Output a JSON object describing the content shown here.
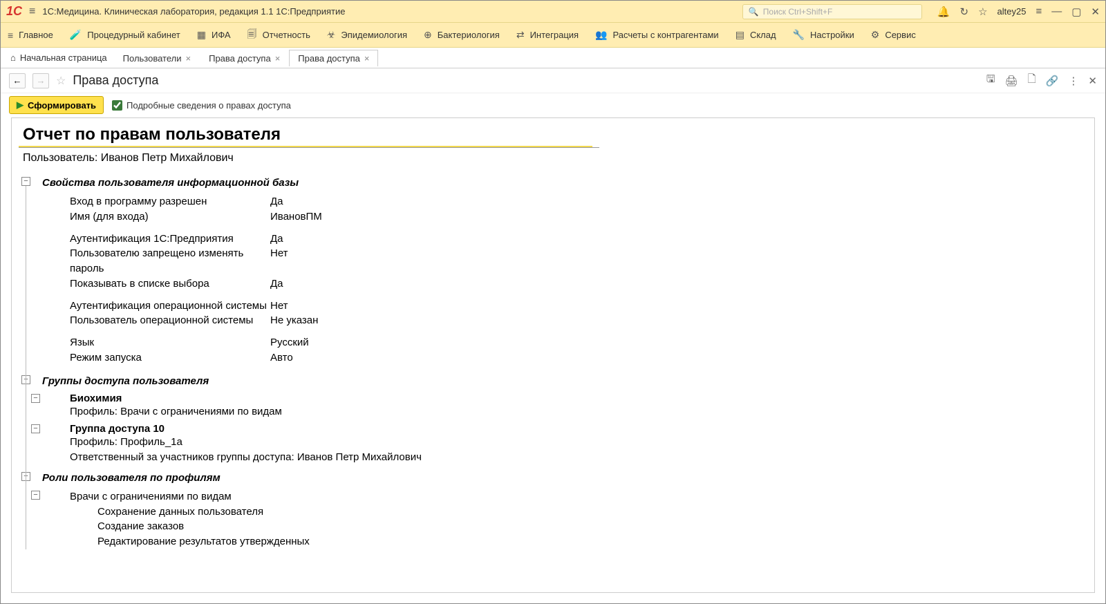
{
  "titlebar": {
    "app_title": "1С:Медицина. Клиническая лаборатория, редакция 1.1 1С:Предприятие",
    "search_placeholder": "Поиск Ctrl+Shift+F",
    "username": "altey25",
    "logo": "1C"
  },
  "mainmenu": [
    {
      "icon": "≡",
      "label": "Главное"
    },
    {
      "icon": "🧪",
      "label": "Процедурный кабинет"
    },
    {
      "icon": "▦",
      "label": "ИФА"
    },
    {
      "icon": "🗐",
      "label": "Отчетность"
    },
    {
      "icon": "☣",
      "label": "Эпидемиология"
    },
    {
      "icon": "⊕",
      "label": "Бактериология"
    },
    {
      "icon": "⇄",
      "label": "Интеграция"
    },
    {
      "icon": "👥",
      "label": "Расчеты с контрагентами"
    },
    {
      "icon": "▤",
      "label": "Склад"
    },
    {
      "icon": "🔧",
      "label": "Настройки"
    },
    {
      "icon": "⚙",
      "label": "Сервис"
    }
  ],
  "tabs": {
    "home": "Начальная страница",
    "items": [
      {
        "label": "Пользователи",
        "active": false
      },
      {
        "label": "Права доступа",
        "active": false
      },
      {
        "label": "Права доступа",
        "active": true
      }
    ]
  },
  "toolbar": {
    "page_title": "Права доступа",
    "generate_label": "Сформировать",
    "checkbox_label": "Подробные сведения о правах доступа"
  },
  "report": {
    "title": "Отчет по правам пользователя",
    "user_prefix": "Пользователь: ",
    "user_name": "Иванов Петр Михайлович",
    "sections": {
      "props_title": "Свойства пользователя информационной базы",
      "groups_title": "Группы доступа пользователя",
      "roles_title": "Роли пользователя по профилям"
    },
    "props": [
      {
        "k": "Вход в программу разрешен",
        "v": "Да"
      },
      {
        "k": "Имя (для входа)",
        "v": "ИвановПМ"
      },
      {
        "gap": true
      },
      {
        "k": "Аутентификация 1С:Предприятия",
        "v": "Да"
      },
      {
        "k": "Пользователю запрещено изменять пароль",
        "v": "Нет"
      },
      {
        "k": "Показывать в списке выбора",
        "v": "Да"
      },
      {
        "gap": true
      },
      {
        "k": "Аутентификация операционной системы",
        "v": "Нет"
      },
      {
        "k": "Пользователь операционной системы",
        "v": "Не указан"
      },
      {
        "gap": true
      },
      {
        "k": "Язык",
        "v": "Русский"
      },
      {
        "k": "Режим запуска",
        "v": "Авто"
      }
    ],
    "groups": [
      {
        "name": "Биохимия",
        "lines": [
          "Профиль: Врачи с ограничениями по видам"
        ]
      },
      {
        "name": "Группа доступа 10",
        "lines": [
          "Профиль: Профиль_1а",
          "Ответственный за участников группы доступа: Иванов Петр Михайлович"
        ]
      }
    ],
    "roles": [
      {
        "profile": "Врачи с ограничениями по видам",
        "roles": [
          "Сохранение данных пользователя",
          "Создание заказов",
          "Редактирование результатов утвержденных"
        ]
      }
    ]
  }
}
